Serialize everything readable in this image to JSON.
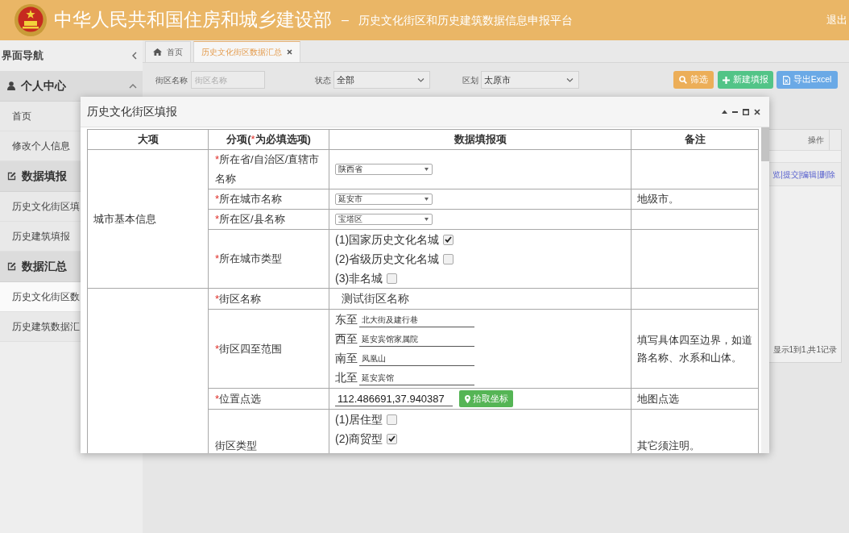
{
  "header": {
    "title": "中华人民共和国住房和城乡建设部",
    "separator": "–",
    "subtitle": "历史文化街区和历史建筑数据信息申报平台",
    "logout": "退出"
  },
  "sidebar": {
    "title": "界面导航",
    "sections": [
      {
        "label": "个人中心",
        "kind": "account",
        "expanded": true,
        "items": [
          {
            "label": "首页",
            "selected": false
          },
          {
            "label": "修改个人信息",
            "selected": false
          }
        ]
      },
      {
        "label": "数据填报",
        "kind": "data",
        "items": [
          {
            "label": "历史文化街区填",
            "selected": false
          },
          {
            "label": "历史建筑填报",
            "selected": false
          }
        ]
      },
      {
        "label": "数据汇总",
        "kind": "data",
        "items": [
          {
            "label": "历史文化街区数",
            "selected": true
          },
          {
            "label": "历史建筑数据汇",
            "selected": false
          }
        ]
      }
    ]
  },
  "tabs": [
    {
      "label": "首页",
      "kind": "home",
      "selected": false,
      "closable": false
    },
    {
      "label": "历史文化街区数据汇总",
      "kind": "page",
      "selected": true,
      "closable": true
    }
  ],
  "filters": [
    {
      "label": "街区名称",
      "kind": "text",
      "placeholder": "街区名称"
    },
    {
      "label": "状态",
      "kind": "select",
      "value": "全部"
    },
    {
      "label": "区划",
      "kind": "select",
      "value": "太原市"
    }
  ],
  "actions": [
    {
      "label": "筛选",
      "kind": "search"
    },
    {
      "label": "新建填报",
      "kind": "add"
    },
    {
      "label": "导出Excel",
      "kind": "export"
    }
  ],
  "results_table": {
    "columns": [
      {
        "text": "操作"
      }
    ],
    "rows": [
      {
        "links": [
          {
            "label": "览"
          },
          {
            "label": "提交"
          },
          {
            "label": "编辑"
          },
          {
            "label": "删除"
          }
        ],
        "separators": [
          "|",
          "|",
          "|"
        ]
      }
    ],
    "footer": "显示1到1,共1记录"
  },
  "dialog": {
    "title": "历史文化街区填报",
    "controls": [
      {
        "kind": "collapse"
      },
      {
        "kind": "minimize"
      },
      {
        "kind": "maximize"
      },
      {
        "kind": "close"
      }
    ],
    "columns": [
      {
        "text": "大项"
      },
      {
        "text": "分项(",
        "mark": "*",
        "after": "为必填选项)"
      },
      {
        "text": "数据填报项"
      },
      {
        "text": "备注"
      }
    ],
    "groups": [
      {
        "label": "城市基本信息",
        "rows": [
          {
            "mark": "*",
            "label": "所在省/自治区/直辖市名称",
            "kind": "select",
            "value": "陕西省"
          },
          {
            "mark": "*",
            "label": "所在城市名称",
            "kind": "select",
            "value": "延安市",
            "note": "地级市。"
          },
          {
            "mark": "*",
            "label": "所在区/县名称",
            "kind": "select",
            "value": "宝塔区"
          },
          {
            "mark": "*",
            "label": "所在城市类型",
            "kind": "checkboxes",
            "options": [
              {
                "label": "(1)国家历史文化名城",
                "checked": true
              },
              {
                "label": "(2)省级历史文化名城",
                "checked": false
              },
              {
                "label": "(3)非名城",
                "checked": false
              }
            ]
          }
        ]
      },
      {
        "rows": [
          {
            "mark": "*",
            "label": "街区名称",
            "kind": "text",
            "value": "测试街区名称"
          },
          {
            "mark": "*",
            "label": "街区四至范围",
            "kind": "bounds",
            "fields": [
              {
                "label": "东至",
                "value": "北大街及建行巷"
              },
              {
                "label": "西至",
                "value": "延安宾馆家属院"
              },
              {
                "label": "南至",
                "value": "凤凰山"
              },
              {
                "label": "北至",
                "value": "延安宾馆"
              }
            ],
            "note": "填写具体四至边界，如道路名称、水系和山体。"
          },
          {
            "mark": "*",
            "label": "位置点选",
            "kind": "coordinate",
            "value": "112.486691,37.940387",
            "button": "拾取坐标",
            "note": "地图点选"
          },
          {
            "label": "街区类型",
            "kind": "checkboxes",
            "options": [
              {
                "label": "(1)居住型",
                "checked": false
              },
              {
                "label": "(2)商贸型",
                "checked": true
              }
            ],
            "note": "其它须注明。"
          }
        ]
      }
    ]
  }
}
